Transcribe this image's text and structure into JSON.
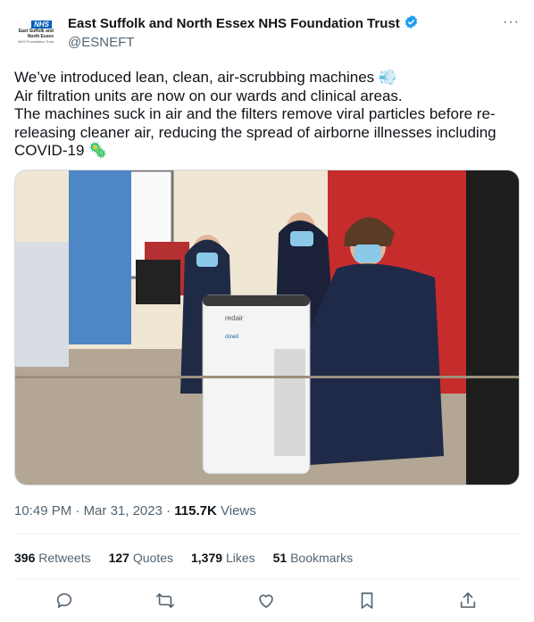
{
  "account": {
    "display_name": "East Suffolk and North Essex NHS Foundation Trust",
    "handle": "@ESNEFT",
    "avatar_logo": "NHS",
    "avatar_line1": "East Suffolk and",
    "avatar_line2": "North Essex",
    "avatar_line3": "NHS Foundation Trust",
    "verified": true,
    "verified_color": "#1d9bf0"
  },
  "tweet": {
    "lines": [
      "We’ve introduced lean, clean, air-scrubbing machines 💨",
      "Air filtration units are now on our wards and clinical areas.",
      "The machines suck in air and the filters remove viral particles before re-releasing cleaner air, reducing the spread of airborne illnesses including COVID-19 🦠"
    ],
    "image_alt": "Three nurses kneeling beside an air filtration unit on a hospital ward",
    "device_brand": "redair",
    "device_sublabel": "clinell"
  },
  "meta": {
    "time": "10:49 PM",
    "sep1": " · ",
    "date": "Mar 31, 2023",
    "sep2": " · ",
    "views": "115.7K",
    "views_label": " Views"
  },
  "stats": {
    "retweets": "396",
    "retweets_label": "Retweets",
    "quotes": "127",
    "quotes_label": "Quotes",
    "likes": "1,379",
    "likes_label": "Likes",
    "bookmarks": "51",
    "bookmarks_label": "Bookmarks"
  },
  "more_menu": "···",
  "icons": [
    "reply-icon",
    "retweet-icon",
    "like-icon",
    "bookmark-icon",
    "share-icon"
  ],
  "colors": {
    "brand_nhs": "#005eb8",
    "text_primary": "#0f1419",
    "text_secondary": "#536471"
  }
}
